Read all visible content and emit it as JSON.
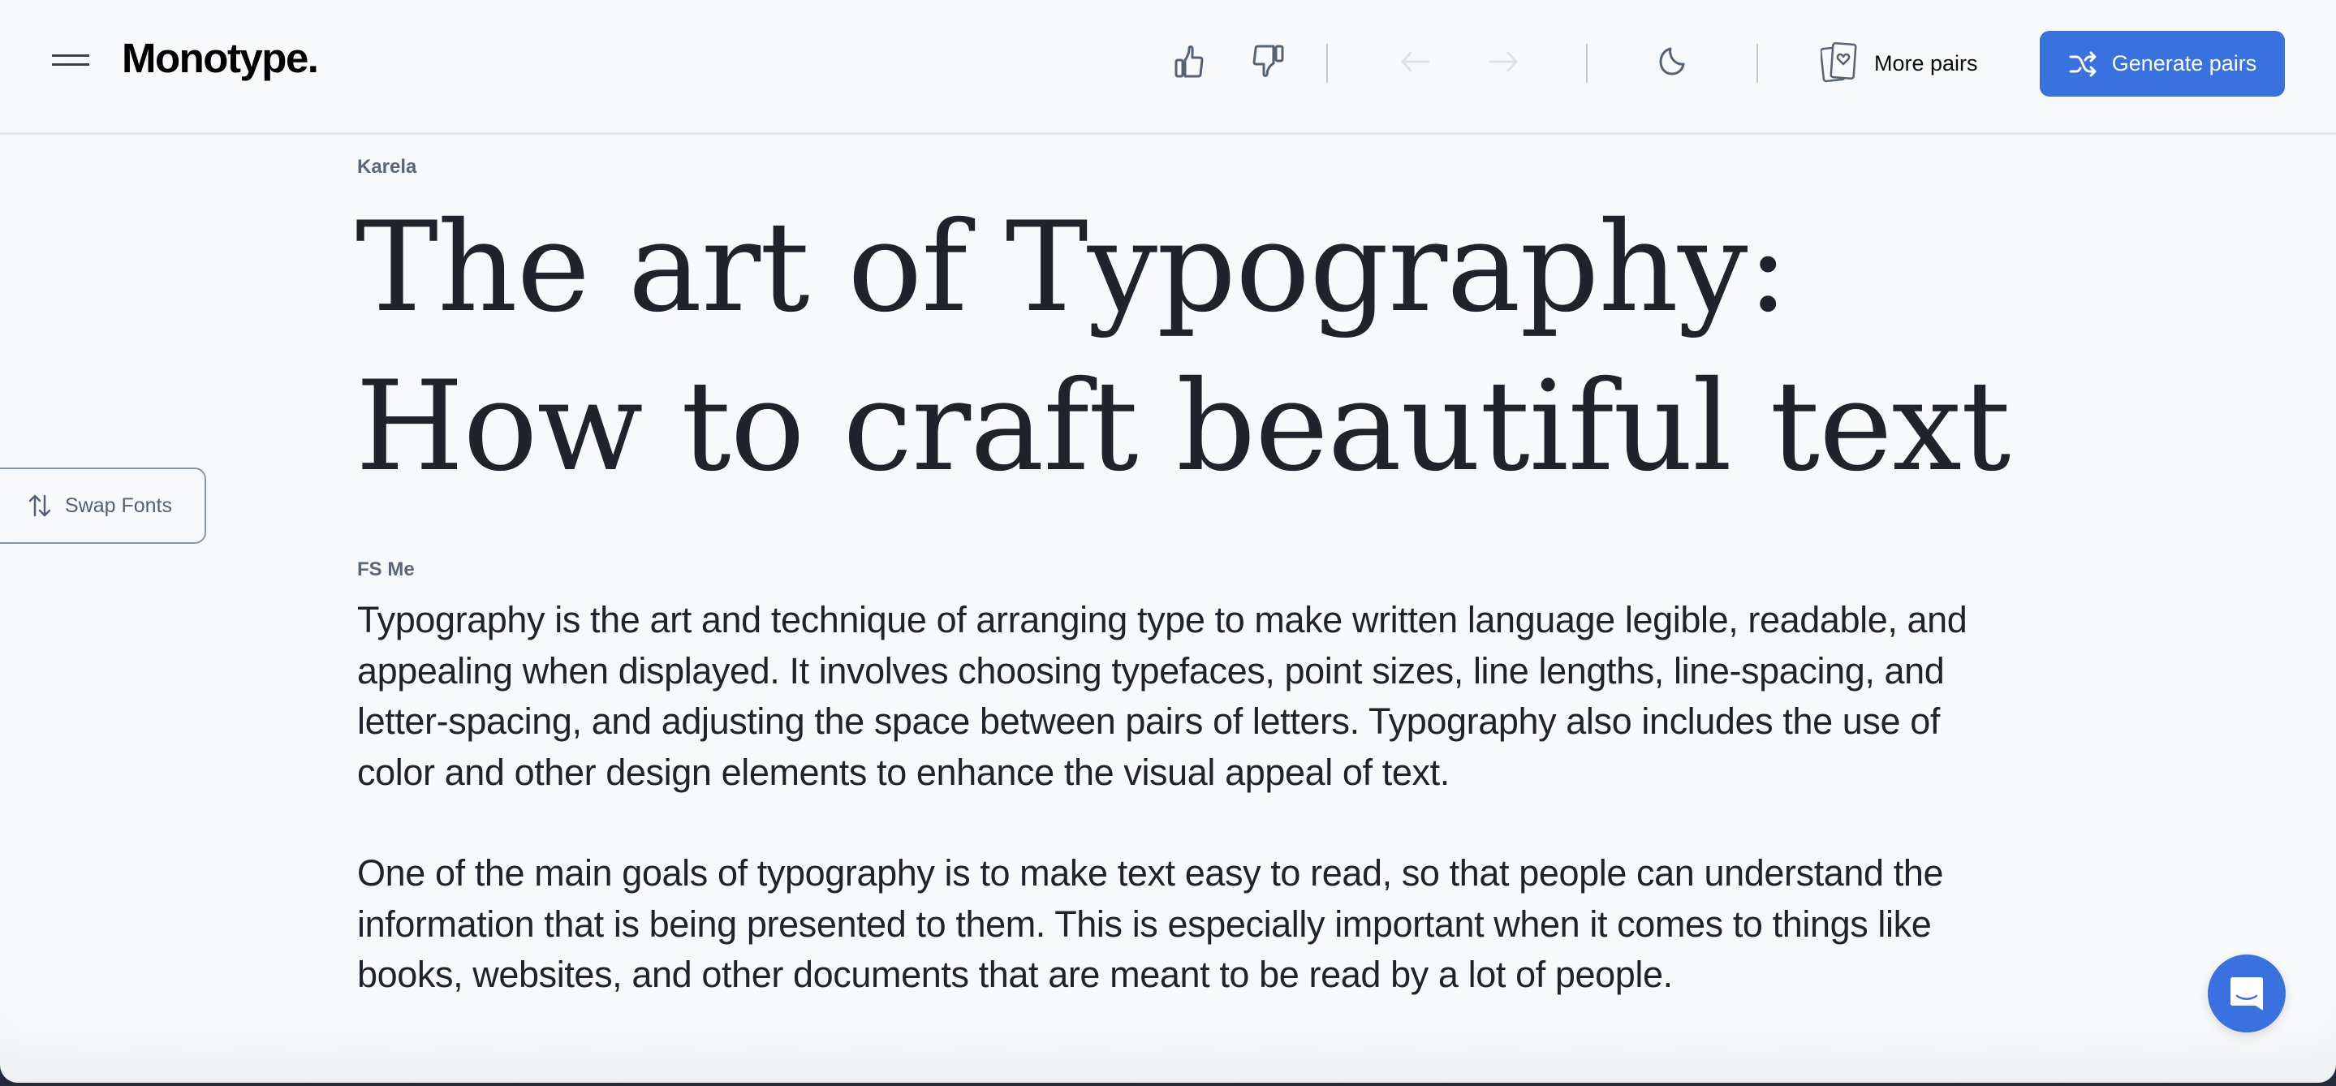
{
  "header": {
    "logo": "Monotype.",
    "icons": {
      "menu": "hamburger-menu-icon",
      "like": "thumbs-up-icon",
      "dislike": "thumbs-down-icon",
      "back": "arrow-left-icon",
      "forward": "arrow-right-icon",
      "theme": "moon-icon",
      "more_pairs": "cards-heart-icon",
      "generate": "shuffle-icon"
    },
    "more_pairs_label": "More pairs",
    "generate_label": "Generate pairs"
  },
  "swap_fonts": {
    "label": "Swap Fonts",
    "icon": "swap-vertical-arrows-icon"
  },
  "heading_section": {
    "font_name": "Karela",
    "text": "The art of Typography: How to craft beautiful text"
  },
  "body_section": {
    "font_name": "FS Me",
    "paragraphs": [
      "Typography is the art and technique of arranging type to make written language legible, readable, and appealing when displayed. It involves choosing typefaces, point sizes, line lengths, line-spacing, and letter-spacing, and adjusting the space between pairs of letters. Typography also includes the use of color and other design elements to enhance the visual appeal of text.",
      "One of the main goals of typography is to make text easy to read, so that people can understand the information that is being presented to them. This is especially important when it comes to things like books, websites, and other documents that are meant to be read by a lot of people."
    ]
  },
  "chat": {
    "icon": "chat-bubble-icon"
  },
  "colors": {
    "accent": "#3971de",
    "background": "#f8f9fb",
    "text": "#1f232a",
    "muted": "#5b6678",
    "icon": "#556175",
    "disabled": "#dfe2e7"
  }
}
